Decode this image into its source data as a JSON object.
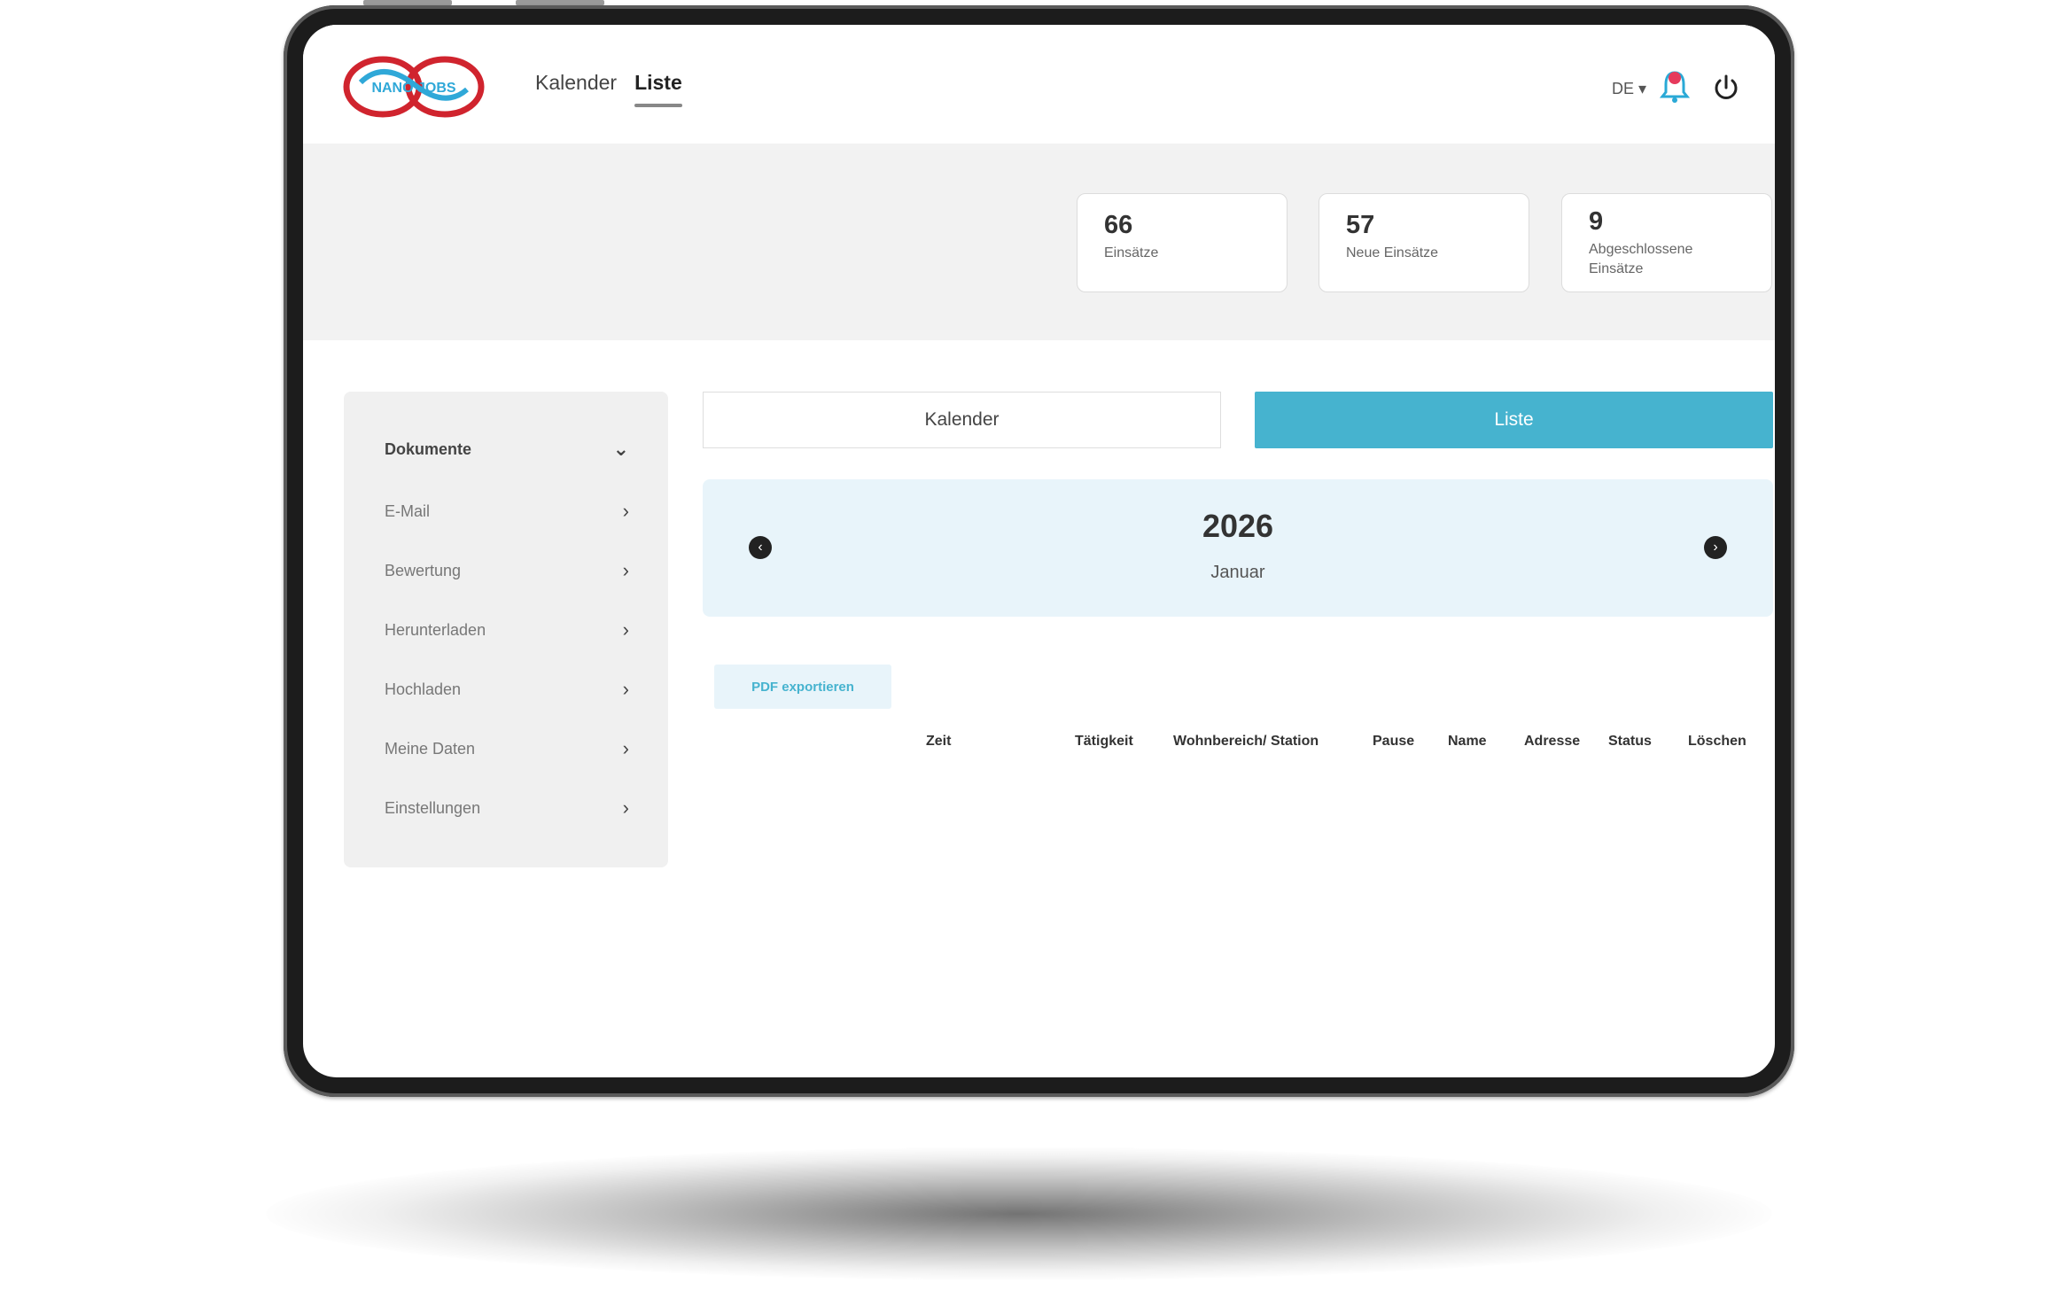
{
  "header": {
    "logo_text": "NANO JOBS",
    "nav": [
      "Kalender",
      "Liste"
    ],
    "lang": "DE ▾"
  },
  "stats": [
    {
      "value": "66",
      "label": "Einsätze"
    },
    {
      "value": "57",
      "label": "Neue Einsätze"
    },
    {
      "value": "9",
      "label": "Abgeschlossene Einsätze"
    }
  ],
  "sidebar": {
    "items": [
      {
        "label": "Dokumente",
        "chevron": "⌄"
      },
      {
        "label": "E-Mail",
        "chevron": "›"
      },
      {
        "label": "Bewertung",
        "chevron": "›"
      },
      {
        "label": "Herunterladen",
        "chevron": "›"
      },
      {
        "label": "Hochladen",
        "chevron": "›"
      },
      {
        "label": "Meine Daten",
        "chevron": "›"
      },
      {
        "label": "Einstellungen",
        "chevron": "›"
      }
    ]
  },
  "view_toggle": {
    "calendar": "Kalender",
    "list": "Liste"
  },
  "period": {
    "year": "2026",
    "month": "Januar",
    "prev": "‹",
    "next": "›"
  },
  "export_button": "PDF exportieren",
  "table": {
    "headers": [
      "Zeit",
      "Tätigkeit",
      "Wohnbereich/ Station",
      "Pause",
      "Name",
      "Adresse",
      "Status",
      "Löschen"
    ]
  },
  "colors": {
    "accent": "#46b3cf",
    "logo_red": "#d0242e",
    "logo_blue": "#2fa8d8",
    "bell": "#2aa9d6"
  }
}
